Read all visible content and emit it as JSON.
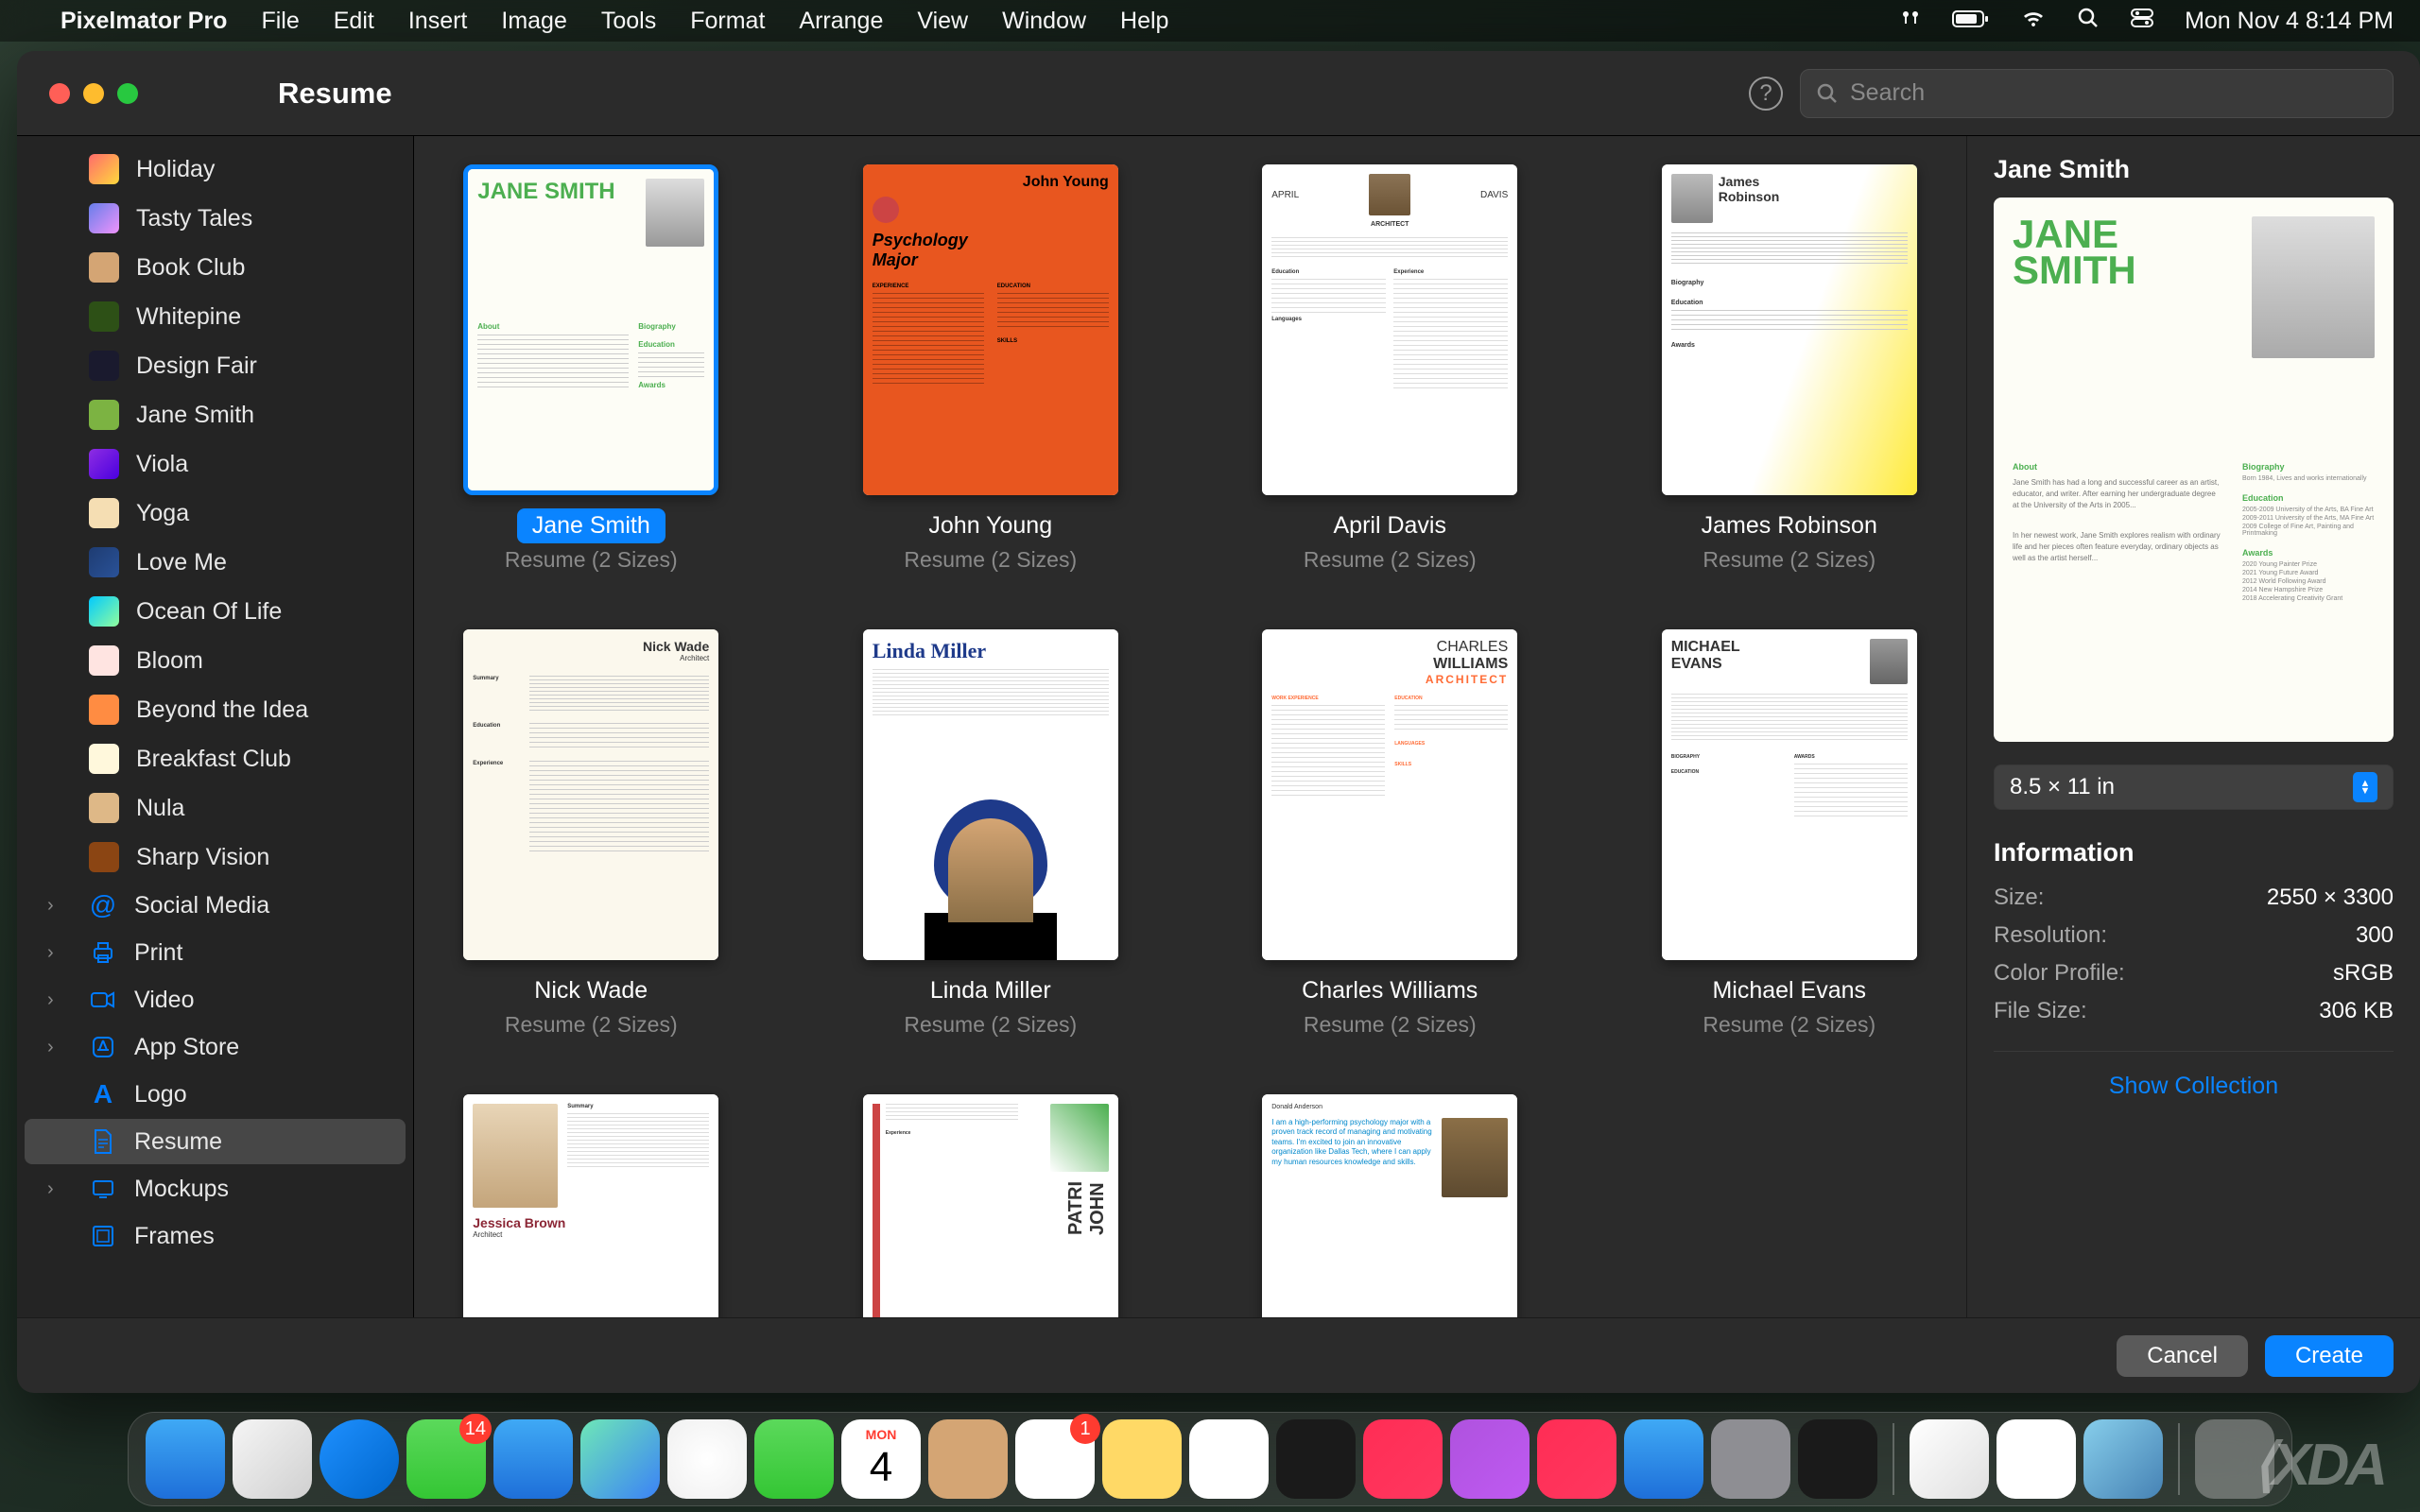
{
  "menubar": {
    "app": "Pixelmator Pro",
    "items": [
      "File",
      "Edit",
      "Insert",
      "Image",
      "Tools",
      "Format",
      "Arrange",
      "View",
      "Window",
      "Help"
    ],
    "clock": "Mon Nov 4  8:14 PM"
  },
  "window": {
    "title": "Resume",
    "search_placeholder": "Search"
  },
  "sidebar": {
    "items": [
      {
        "label": "Holiday",
        "cls": "si-gradient1"
      },
      {
        "label": "Tasty Tales",
        "cls": "si-gradient2"
      },
      {
        "label": "Book Club",
        "cls": "si-book"
      },
      {
        "label": "Whitepine",
        "cls": "si-pine"
      },
      {
        "label": "Design Fair",
        "cls": "si-design"
      },
      {
        "label": "Jane Smith",
        "cls": "si-jane"
      },
      {
        "label": "Viola",
        "cls": "si-viola"
      },
      {
        "label": "Yoga",
        "cls": "si-yoga"
      },
      {
        "label": "Love Me",
        "cls": "si-love"
      },
      {
        "label": "Ocean Of Life",
        "cls": "si-ocean"
      },
      {
        "label": "Bloom",
        "cls": "si-bloom"
      },
      {
        "label": "Beyond the Idea",
        "cls": "si-beyond"
      },
      {
        "label": "Breakfast Club",
        "cls": "si-breakfast"
      },
      {
        "label": "Nula",
        "cls": "si-nula"
      },
      {
        "label": "Sharp Vision",
        "cls": "si-sharp"
      }
    ],
    "groups": [
      {
        "label": "Social Media",
        "icon": "@"
      },
      {
        "label": "Print",
        "icon": "print"
      },
      {
        "label": "Video",
        "icon": "video"
      },
      {
        "label": "App Store",
        "icon": "appstore"
      },
      {
        "label": "Logo",
        "icon": "A",
        "no_chevron": true
      },
      {
        "label": "Resume",
        "icon": "doc",
        "active": true,
        "no_chevron": true
      },
      {
        "label": "Mockups",
        "icon": "mockup"
      },
      {
        "label": "Frames",
        "icon": "frame",
        "no_chevron": true
      }
    ]
  },
  "templates": [
    {
      "name": "Jane Smith",
      "sub": "Resume (2 Sizes)",
      "selected": true
    },
    {
      "name": "John Young",
      "sub": "Resume (2 Sizes)"
    },
    {
      "name": "April Davis",
      "sub": "Resume (2 Sizes)"
    },
    {
      "name": "James Robinson",
      "sub": "Resume (2 Sizes)"
    },
    {
      "name": "Nick Wade",
      "sub": "Resume (2 Sizes)"
    },
    {
      "name": "Linda Miller",
      "sub": "Resume (2 Sizes)"
    },
    {
      "name": "Charles Williams",
      "sub": "Resume (2 Sizes)"
    },
    {
      "name": "Michael Evans",
      "sub": "Resume (2 Sizes)"
    },
    {
      "name": "Jessica Brown",
      "sub": ""
    },
    {
      "name": "Patrick John",
      "sub": ""
    },
    {
      "name": "Donald Anderson",
      "sub": ""
    }
  ],
  "detail": {
    "title": "Jane Smith",
    "size_label": "8.5 × 11 in",
    "info_header": "Information",
    "rows": [
      {
        "k": "Size:",
        "v": "2550 × 3300"
      },
      {
        "k": "Resolution:",
        "v": "300"
      },
      {
        "k": "Color Profile:",
        "v": "sRGB"
      },
      {
        "k": "File Size:",
        "v": "306 KB"
      }
    ],
    "show_collection": "Show Collection"
  },
  "footer": {
    "cancel": "Cancel",
    "create": "Create"
  },
  "dock": {
    "messages_badge": "14",
    "reminders_badge": "1",
    "cal_day": "MON",
    "cal_num": "4"
  }
}
